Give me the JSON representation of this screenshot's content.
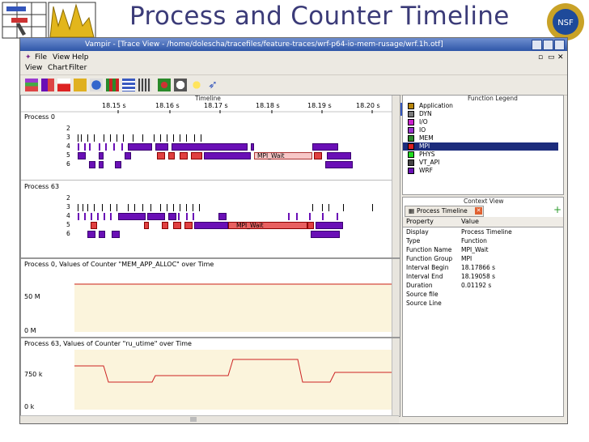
{
  "slide": {
    "title": "Process and Counter Timeline"
  },
  "window": {
    "title": "Vampir - [Trace View - /home/dolescha/tracefiles/feature-traces/wrf-p64-io-mem-rusage/wrf.1h.otf]",
    "menu": [
      "File",
      "View",
      "Help"
    ],
    "menu2": [
      "View",
      "Chart",
      "Filter"
    ]
  },
  "timeline": {
    "header": "Timeline",
    "ticks": [
      "18.15 s",
      "18.16 s",
      "18.17 s",
      "18.18 s",
      "18.19 s",
      "18.20 s"
    ],
    "process0": {
      "label": "Process 0",
      "rows": [
        "2",
        "3",
        "4",
        "5",
        "6"
      ],
      "annotation": "MPI_Wait"
    },
    "process63": {
      "label": "Process 63",
      "rows": [
        "2",
        "3",
        "4",
        "5",
        "6"
      ],
      "annotation": "MPI_Wait"
    }
  },
  "counter1": {
    "title": "Process 0, Values of Counter \"MEM_APP_ALLOC\" over Time",
    "y_labels": [
      "50 M",
      "0 M"
    ]
  },
  "counter2": {
    "title": "Process 63, Values of Counter \"ru_utime\" over Time",
    "y_labels": [
      "750 k",
      "0 k"
    ]
  },
  "legend": {
    "header": "Function Legend",
    "items": [
      {
        "name": "Application",
        "color": "#b8860b"
      },
      {
        "name": "DYN",
        "color": "#7a7a7a"
      },
      {
        "name": "I/O",
        "color": "#cc22cc"
      },
      {
        "name": "IO",
        "color": "#9933cc"
      },
      {
        "name": "MEM",
        "color": "#2b8a2b"
      },
      {
        "name": "MPI",
        "color": "#dd2222"
      },
      {
        "name": "PHYS",
        "color": "#22dd22"
      },
      {
        "name": "VT_API",
        "color": "#444444"
      },
      {
        "name": "WRF",
        "color": "#6a0fb6"
      }
    ],
    "selected": "MPI"
  },
  "context": {
    "header": "Context View",
    "tab": "Process Timeline",
    "col_property": "Property",
    "col_value": "Value",
    "rows": [
      {
        "k": "Display",
        "v": "Process Timeline"
      },
      {
        "k": "Type",
        "v": "Function"
      },
      {
        "k": "Function Name",
        "v": "MPI_Wait"
      },
      {
        "k": "Function Group",
        "v": "MPI"
      },
      {
        "k": "Interval Begin",
        "v": "18.17866 s"
      },
      {
        "k": "Interval End",
        "v": "18.19058 s"
      },
      {
        "k": "Duration",
        "v": "0.01192 s"
      },
      {
        "k": "Source file",
        "v": ""
      },
      {
        "k": "Source Line",
        "v": ""
      }
    ]
  }
}
